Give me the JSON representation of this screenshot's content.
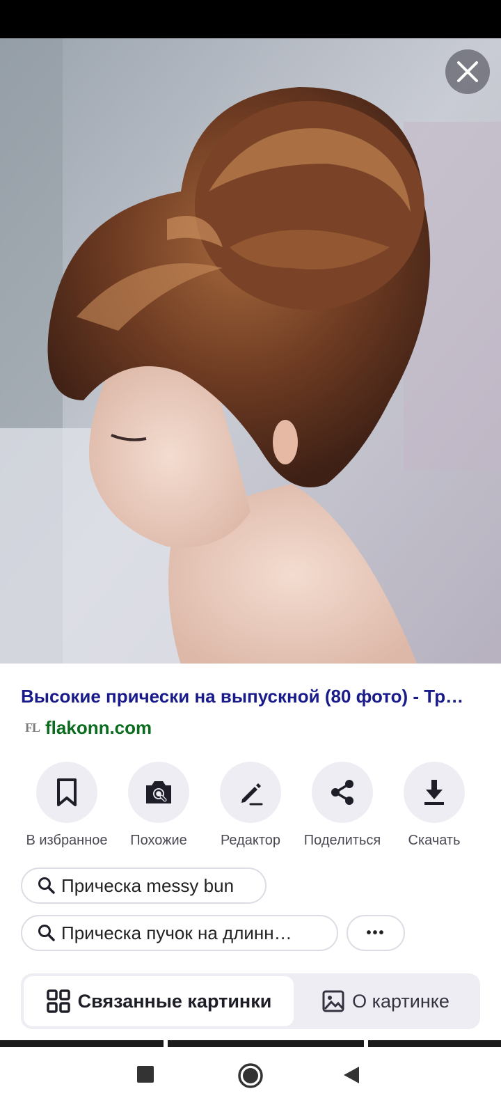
{
  "result": {
    "title": "Высокие прически на выпускной (80 фото) - Тр…",
    "source_logo": "FL",
    "source_domain": "flakonn.com"
  },
  "actions": [
    {
      "label": "В избранное",
      "icon": "bookmark-icon"
    },
    {
      "label": "Похожие",
      "icon": "camera-search-icon"
    },
    {
      "label": "Редактор",
      "icon": "pencil-icon"
    },
    {
      "label": "Поделиться",
      "icon": "share-icon"
    },
    {
      "label": "Скачать",
      "icon": "download-icon"
    }
  ],
  "suggestions": [
    {
      "text": "Прическа messy bun"
    },
    {
      "text": "Прическа пучок на длинн…"
    }
  ],
  "more_button": {
    "label": "•••"
  },
  "tabs": [
    {
      "label": "Связанные картинки",
      "active": true,
      "icon": "grid-icon"
    },
    {
      "label": "О картинке",
      "active": false,
      "icon": "image-icon"
    }
  ],
  "colors": {
    "title": "#1a1b8a",
    "domain": "#0b6b1e",
    "button_bg": "#efedf4"
  }
}
